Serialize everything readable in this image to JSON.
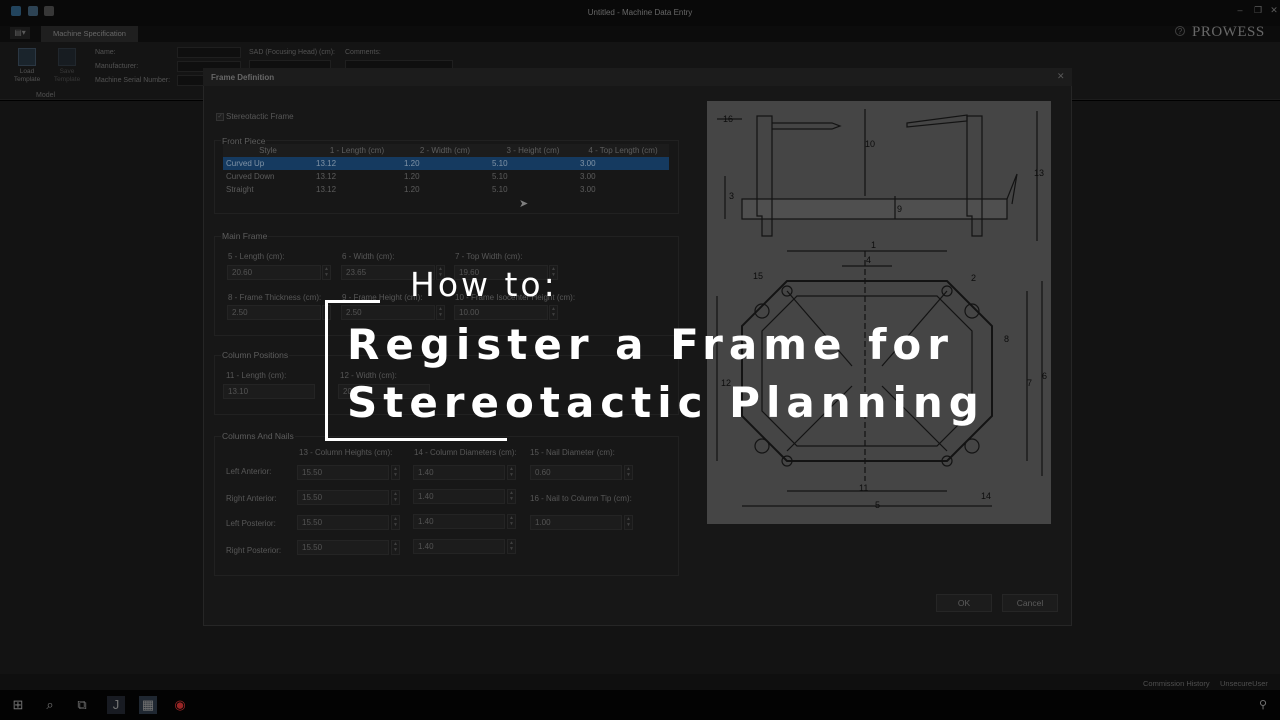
{
  "window": {
    "title": "Untitled - Machine Data Entry",
    "brand": "PROWESS"
  },
  "ribbon": {
    "tab": "Machine Specification",
    "load_template": "Load Template",
    "save_template": "Save Template",
    "group_label": "Model",
    "name_label": "Name:",
    "manufacturer_label": "Manufacturer:",
    "serial_label": "Machine Serial Number:",
    "sad_label": "SAD (Focusing Head) (cm):",
    "comments_label": "Comments:"
  },
  "dialog": {
    "title": "Frame Definition",
    "stereotactic_checkbox": "Stereotactic Frame",
    "front_piece": {
      "title": "Front Piece",
      "columns": [
        "Style",
        "1 - Length (cm)",
        "2 - Width (cm)",
        "3 - Height (cm)",
        "4 - Top Length (cm)"
      ],
      "rows": [
        [
          "Curved Up",
          "13.12",
          "1.20",
          "5.10",
          "3.00"
        ],
        [
          "Curved Down",
          "13.12",
          "1.20",
          "5.10",
          "3.00"
        ],
        [
          "Straight",
          "13.12",
          "1.20",
          "5.10",
          "3.00"
        ]
      ]
    },
    "main_frame": {
      "title": "Main Frame",
      "length_label": "5 - Length (cm):",
      "length_value": "20.60",
      "width_label": "6 - Width (cm):",
      "width_value": "23.65",
      "top_width_label": "7 - Top Width (cm):",
      "top_width_value": "19.60",
      "thickness_label": "8 - Frame Thickness (cm):",
      "thickness_value": "2.50",
      "frame_height_label": "9 - Frame Height (cm):",
      "frame_height_value": "2.50",
      "isocenter_label": "10 - Frame Isocenter Height (cm):",
      "isocenter_value": "10.00"
    },
    "column_positions": {
      "title": "Column Positions",
      "length_label": "11 - Length (cm):",
      "length_value": "13.10",
      "width_label": "12 - Width (cm):",
      "width_value": "20"
    },
    "columns_nails": {
      "title": "Columns And Nails",
      "heights_label": "13 - Column Heights (cm):",
      "diameters_label": "14 - Column Diameters (cm):",
      "nail_diameter_label": "15 - Nail Diameter (cm):",
      "nail_diameter_value": "0.60",
      "nail_tip_label": "16 - Nail to Column Tip (cm):",
      "nail_tip_value": "1.00",
      "rows": [
        {
          "label": "Left Anterior:",
          "height": "15.50",
          "diameter": "1.40"
        },
        {
          "label": "Right Anterior:",
          "height": "15.50",
          "diameter": "1.40"
        },
        {
          "label": "Left Posterior:",
          "height": "15.50",
          "diameter": "1.40"
        },
        {
          "label": "Right Posterior:",
          "height": "15.50",
          "diameter": "1.40"
        }
      ]
    },
    "ok": "OK",
    "cancel": "Cancel"
  },
  "diagram": {
    "labels": [
      "16",
      "10",
      "13",
      "3",
      "9",
      "1",
      "4",
      "15",
      "2",
      "8",
      "12",
      "7",
      "6",
      "11",
      "14",
      "5"
    ]
  },
  "overlay": {
    "line0": "How to:",
    "line1": "Register a Frame for",
    "line2": "Stereotactic Planning"
  },
  "status": {
    "commission_history": "Commission History",
    "user": "UnsecureUser"
  }
}
